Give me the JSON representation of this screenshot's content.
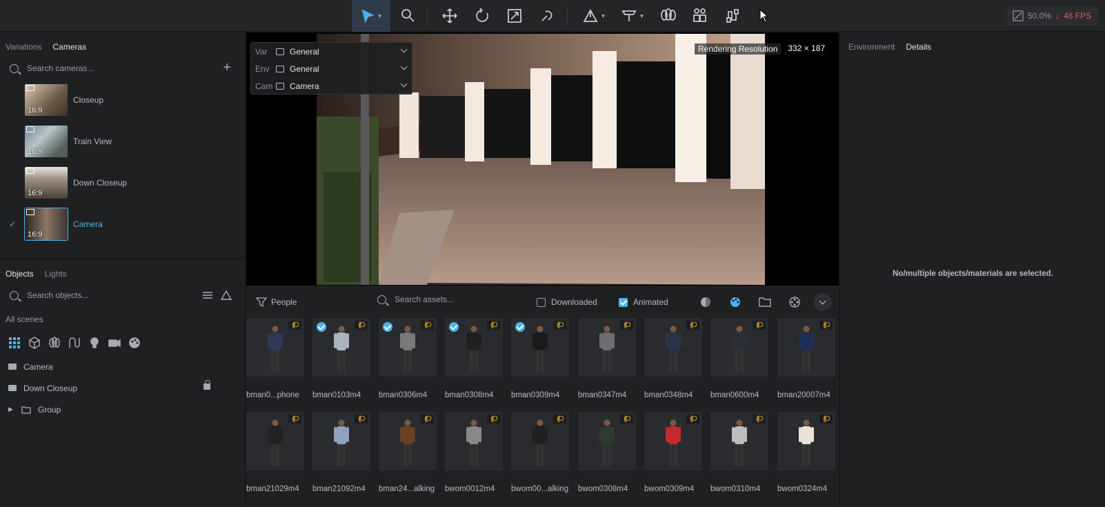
{
  "toolbar": {
    "tools": [
      "select-tool",
      "material-tool",
      "move-tool",
      "rotate-tool",
      "scale-tool",
      "snap-tool",
      "place-tool",
      "paint-tool",
      "vegetation-tool",
      "people-tool",
      "path-tool"
    ],
    "zoom": "50.0%",
    "fps": "48 FPS"
  },
  "left": {
    "tabs": [
      "Variations",
      "Cameras"
    ],
    "search_placeholder": "Search cameras...",
    "cameras": [
      {
        "label": "Closeup",
        "aspect": "16:9",
        "selected": false
      },
      {
        "label": "Train View",
        "aspect": "16:9",
        "selected": false
      },
      {
        "label": "Down Closeup",
        "aspect": "16:9",
        "selected": false
      },
      {
        "label": "Camera",
        "aspect": "16:9",
        "selected": true
      }
    ],
    "obj_tabs": [
      "Objects",
      "Lights"
    ],
    "obj_search_placeholder": "Search objects...",
    "all_scenes": "All scenes",
    "objects": [
      {
        "label": "Camera"
      },
      {
        "label": "Down Closeup"
      },
      {
        "label": "Group"
      }
    ]
  },
  "viewport": {
    "selector": [
      {
        "key": "Var",
        "value": "General"
      },
      {
        "key": "Env",
        "value": "General"
      },
      {
        "key": "Cam",
        "value": "Camera"
      }
    ],
    "resolution_label": "Rendering Resolution",
    "resolution_value": "332 × 187"
  },
  "assets": {
    "category": "People",
    "search_placeholder": "Search assets...",
    "downloaded_label": "Downloaded",
    "animated_label": "Animated",
    "items": [
      {
        "name": "bman0...phone",
        "checked": false,
        "color": "#2c3a55"
      },
      {
        "name": "bman0103m4",
        "checked": true,
        "color": "#a9b4c2"
      },
      {
        "name": "bman0306m4",
        "checked": true,
        "color": "#7a7a7a"
      },
      {
        "name": "bman0308m4",
        "checked": true,
        "color": "#202020"
      },
      {
        "name": "bman0309m4",
        "checked": true,
        "color": "#1a1a1a"
      },
      {
        "name": "bman0347m4",
        "checked": false,
        "color": "#6e6e70"
      },
      {
        "name": "bman0348m4",
        "checked": false,
        "color": "#283448"
      },
      {
        "name": "bman0600m4",
        "checked": false,
        "color": "#2a2e38"
      },
      {
        "name": "bman20007m4",
        "checked": false,
        "color": "#1d2d58"
      },
      {
        "name": "bman21029m4",
        "checked": false,
        "color": "#222222"
      },
      {
        "name": "bman21092m4",
        "checked": false,
        "color": "#8fa3bf"
      },
      {
        "name": "bman24...alking",
        "checked": false,
        "color": "#6b3e26"
      },
      {
        "name": "bwom0012m4",
        "checked": false,
        "color": "#888888"
      },
      {
        "name": "bwom00...alking",
        "checked": false,
        "color": "#202020"
      },
      {
        "name": "bwom0308m4",
        "checked": false,
        "color": "#2d3a30"
      },
      {
        "name": "bwom0309m4",
        "checked": false,
        "color": "#c42a2a"
      },
      {
        "name": "bwom0310m4",
        "checked": false,
        "color": "#bdbdbd"
      },
      {
        "name": "bwom0324m4",
        "checked": false,
        "color": "#e8e2d8"
      }
    ]
  },
  "right": {
    "tabs": [
      "Environment",
      "Details"
    ],
    "empty_message": "No/multiple objects/materials are selected."
  }
}
